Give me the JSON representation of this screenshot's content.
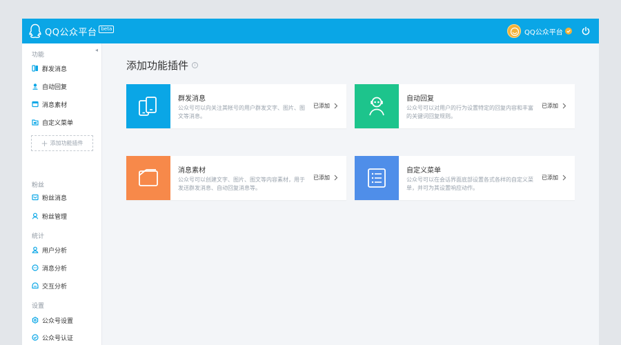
{
  "app": {
    "brand": "QQ公众平台",
    "beta": "beta",
    "account_name": "QQ公众平台"
  },
  "colors": {
    "topbar": "#0aa6e6",
    "card_blue": "#0aa6e6",
    "card_green": "#1dc48c",
    "card_orange": "#f7894a",
    "card_indigo": "#4f8ee9",
    "avatar": "#f2b23a"
  },
  "sidebar": {
    "groups": [
      {
        "title": "功能",
        "items": [
          {
            "label": "群发消息",
            "icon": "broadcast-icon"
          },
          {
            "label": "自动回复",
            "icon": "auto-reply-icon"
          },
          {
            "label": "消息素材",
            "icon": "material-icon"
          },
          {
            "label": "自定义菜单",
            "icon": "menu-icon"
          }
        ]
      },
      {
        "title": "粉丝",
        "items": [
          {
            "label": "粉丝消息",
            "icon": "fan-message-icon"
          },
          {
            "label": "粉丝管理",
            "icon": "fan-manage-icon"
          }
        ]
      },
      {
        "title": "统计",
        "items": [
          {
            "label": "用户分析",
            "icon": "user-analysis-icon"
          },
          {
            "label": "消息分析",
            "icon": "message-analysis-icon"
          },
          {
            "label": "交互分析",
            "icon": "interaction-analysis-icon"
          }
        ]
      },
      {
        "title": "设置",
        "items": [
          {
            "label": "公众号设置",
            "icon": "settings-icon"
          },
          {
            "label": "公众号认证",
            "icon": "verify-icon"
          }
        ]
      }
    ],
    "add_plugin_label": "添加功能插件"
  },
  "main": {
    "title": "添加功能插件",
    "info_glyph": "i",
    "cards": [
      {
        "title": "群发消息",
        "desc": "公众号可以向关注其帐号的用户群发文字、图片、图文等消息。",
        "status": "已添加",
        "icon": "phone-icon"
      },
      {
        "title": "自动回复",
        "desc": "公众号可以对用户的行为设置特定的回复内容和丰富的关键词回复规则。",
        "status": "已添加",
        "icon": "robot-icon"
      },
      {
        "title": "消息素材",
        "desc": "公众号可以创建文字、图片、图文等内容素材，用于发送群发消息、自动回复消息等。",
        "status": "已添加",
        "icon": "folder-icon"
      },
      {
        "title": "自定义菜单",
        "desc": "公众号可以在会话界面底部设置各式各样的自定义菜单，并可为其设置响应动作。",
        "status": "已添加",
        "icon": "list-icon"
      }
    ]
  }
}
